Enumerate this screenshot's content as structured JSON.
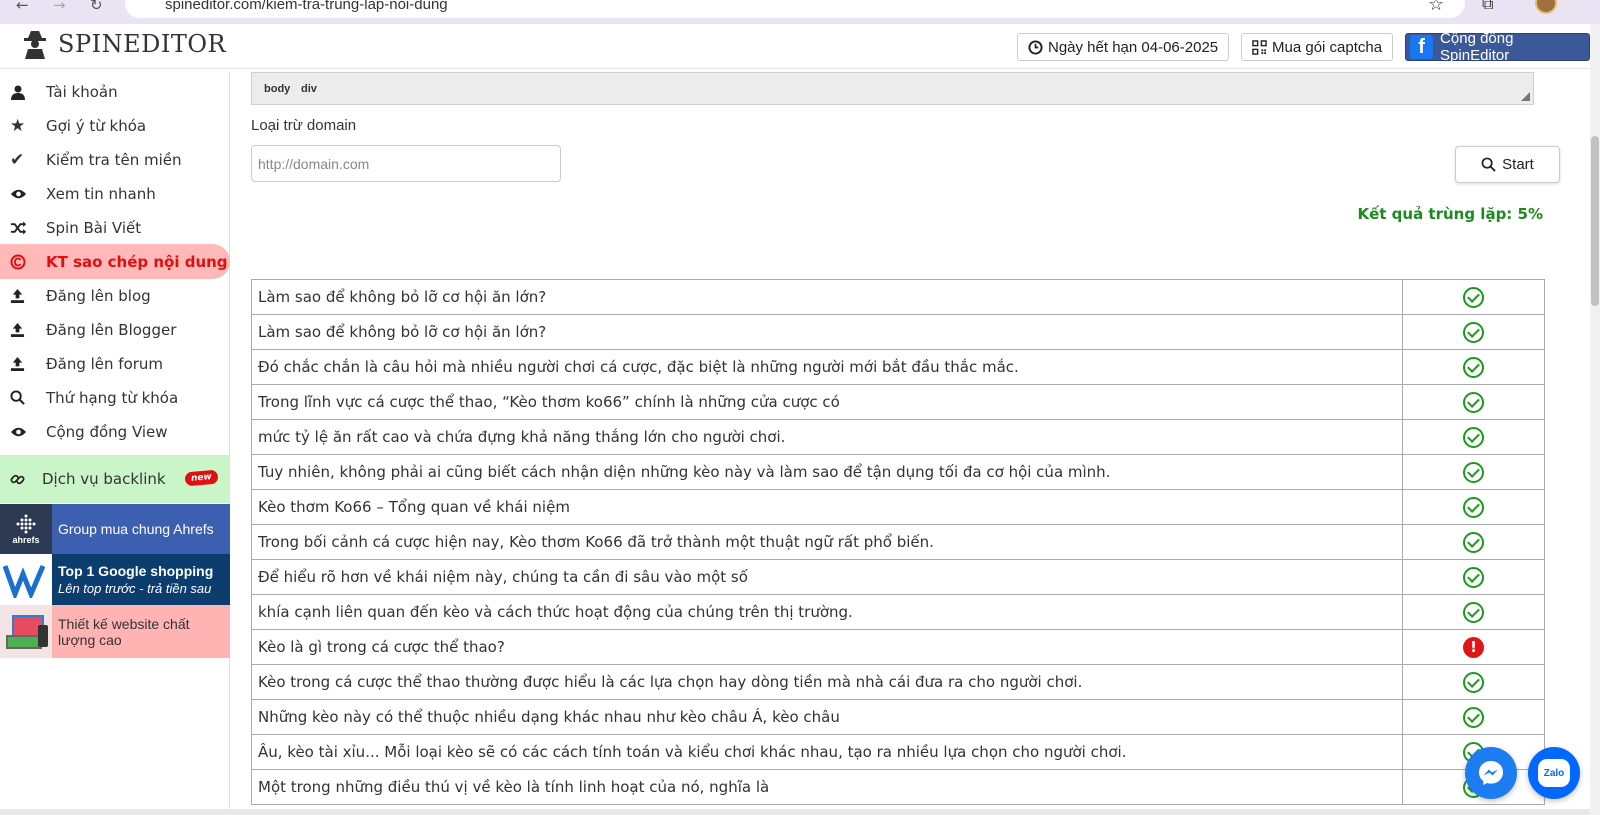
{
  "browser": {
    "url": "spineditor.com/kiem-tra-trung-lap-noi-dung"
  },
  "header": {
    "logo_text": "SPINEDITOR",
    "expiry_label": "Ngày hết hạn 04-06-2025",
    "captcha_label": "Mua gói captcha",
    "community_label": "Cộng đồng SpinEditor"
  },
  "sidebar": {
    "items": [
      {
        "label": "Tài khoản",
        "icon": "user-icon"
      },
      {
        "label": "Gợi ý từ khóa",
        "icon": "star-icon"
      },
      {
        "label": "Kiểm tra tên miền",
        "icon": "check-icon"
      },
      {
        "label": "Xem tin nhanh",
        "icon": "eye-icon"
      },
      {
        "label": "Spin Bài Viết",
        "icon": "shuffle-icon"
      },
      {
        "label": "KT sao chép nội dung",
        "icon": "copyright-icon",
        "active": true
      },
      {
        "label": "Đăng lên blog",
        "icon": "upload-icon"
      },
      {
        "label": "Đăng lên Blogger",
        "icon": "upload-icon"
      },
      {
        "label": "Đăng lên forum",
        "icon": "upload-icon"
      },
      {
        "label": "Thứ hạng từ khóa",
        "icon": "search-icon"
      },
      {
        "label": "Cộng đồng View",
        "icon": "eye-icon"
      }
    ],
    "backlink_label": "Dịch vụ backlink",
    "new_badge": "new",
    "promo_ahrefs": "Group mua chung Ahrefs",
    "ahrefs_logo": "ahrefs",
    "promo_google_title": "Top 1 Google shopping",
    "promo_google_sub": "Lên top trước - trả tiền sau",
    "promo_web": "Thiết kế website chất lượng cao"
  },
  "editor": {
    "path": [
      "body",
      "div"
    ]
  },
  "form": {
    "exclude_label": "Loại trừ domain",
    "domain_placeholder": "http://domain.com",
    "start_label": "Start"
  },
  "result_label": "Kết quả trùng lặp: 5%",
  "rows": [
    {
      "text": "Làm sao để không bỏ lỡ cơ hội ăn lớn?",
      "status": "ok"
    },
    {
      "text": "Làm sao để không bỏ lỡ cơ hội ăn lớn?",
      "status": "ok"
    },
    {
      "text": "Đó chắc chắn là câu hỏi mà nhiều người chơi cá cược, đặc biệt là những người mới bắt đầu thắc mắc.",
      "status": "ok"
    },
    {
      "text": "Trong lĩnh vực cá cược thể thao, “Kèo thơm ko66” chính là những cửa cược có",
      "status": "ok"
    },
    {
      "text": "mức tỷ lệ ăn rất cao và chứa đựng khả năng thắng lớn cho người chơi.",
      "status": "ok"
    },
    {
      "text": "Tuy nhiên, không phải ai cũng biết cách nhận diện những kèo này và làm sao để tận dụng tối đa cơ hội của mình.",
      "status": "ok"
    },
    {
      "text": "Kèo thơm Ko66 – Tổng quan về khái niệm",
      "status": "ok"
    },
    {
      "text": "Trong bối cảnh cá cược hiện nay, Kèo thơm Ko66 đã trở thành một thuật ngữ rất phổ biến.",
      "status": "ok"
    },
    {
      "text": "Để hiểu rõ hơn về khái niệm này, chúng ta cần đi sâu vào một số",
      "status": "ok"
    },
    {
      "text": "khía cạnh liên quan đến kèo và cách thức hoạt động của chúng trên thị trường.",
      "status": "ok"
    },
    {
      "text": "Kèo là gì trong cá cược thể thao?",
      "status": "dup"
    },
    {
      "text": "Kèo trong cá cược thể thao thường được hiểu là các lựa chọn hay dòng tiền mà nhà cái đưa ra cho người chơi.",
      "status": "ok"
    },
    {
      "text": "Những kèo này có thể thuộc nhiều dạng khác nhau như kèo châu Á, kèo châu",
      "status": "ok"
    },
    {
      "text": "Âu, kèo tài xỉu... Mỗi loại kèo sẽ có các cách tính toán và kiểu chơi khác nhau, tạo ra nhiều lựa chọn cho người chơi.",
      "status": "ok"
    },
    {
      "text": "Một trong những điều thú vị về kèo là tính linh hoạt của nó, nghĩa là",
      "status": "ok"
    }
  ],
  "fab": {
    "zalo": "Zalo"
  },
  "colors": {
    "accent_active": "#e01010",
    "active_bg": "#ffb9b9",
    "ok": "#1a9a1a",
    "dup": "#e01515",
    "result": "#1e8a1e"
  }
}
